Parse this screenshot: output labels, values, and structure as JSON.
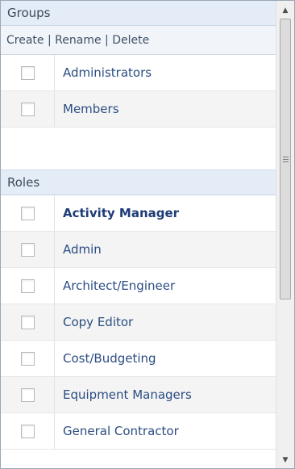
{
  "groups": {
    "header": "Groups",
    "actions": {
      "create": "Create",
      "rename": "Rename",
      "delete": "Delete",
      "separator": "|"
    },
    "items": [
      {
        "label": "Administrators",
        "checked": false
      },
      {
        "label": "Members",
        "checked": false
      }
    ]
  },
  "roles": {
    "header": "Roles",
    "items": [
      {
        "label": "Activity Manager",
        "checked": false,
        "selected": true
      },
      {
        "label": "Admin",
        "checked": false
      },
      {
        "label": "Architect/Engineer",
        "checked": false
      },
      {
        "label": "Copy Editor",
        "checked": false
      },
      {
        "label": "Cost/Budgeting",
        "checked": false
      },
      {
        "label": "Equipment Managers",
        "checked": false
      },
      {
        "label": "General Contractor",
        "checked": false
      }
    ]
  },
  "scrollbar": {
    "up_arrow": "▲",
    "down_arrow": "▼",
    "thumb_fraction": 0.6
  }
}
